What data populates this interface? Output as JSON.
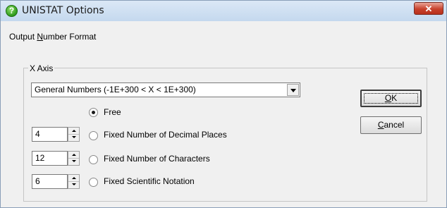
{
  "window": {
    "title": "UNISTAT Options",
    "close_glyph": "✕"
  },
  "format": {
    "prefix": "Output ",
    "mnemonic": "N",
    "suffix": "umber Format"
  },
  "xaxis": {
    "group_label": "X Axis",
    "combo_value": "General Numbers (-1E+300 < X < 1E+300)",
    "options": [
      {
        "label": "Free",
        "checked": true
      },
      {
        "label": "Fixed Number of Decimal Places",
        "checked": false,
        "spin": "4"
      },
      {
        "label": "Fixed Number of Characters",
        "checked": false,
        "spin": "12"
      },
      {
        "label": "Fixed Scientific Notation",
        "checked": false,
        "spin": "6"
      }
    ]
  },
  "buttons": {
    "ok_mnemonic": "O",
    "ok_rest": "K",
    "cancel_mnemonic": "C",
    "cancel_rest": "ancel"
  },
  "icons": {
    "app": "help-question-icon"
  },
  "colors": {
    "title_gradient_top": "#dbe8f6",
    "close_red": "#c8412c"
  }
}
